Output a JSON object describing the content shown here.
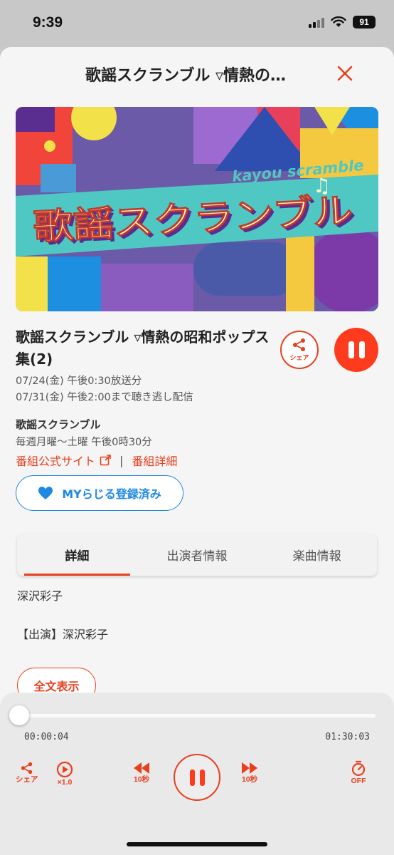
{
  "status_bar": {
    "time": "9:39",
    "battery": "91"
  },
  "header": {
    "title": "歌謡スクランブル ▿情熱の…"
  },
  "artwork": {
    "subtitle_text": "kayou scramble",
    "title_text": "歌謡スクランブル"
  },
  "episode": {
    "title": "歌謡スクランブル ▿情熱の昭和ポップス集(2)",
    "broadcast": "07/24(金) 午後0:30放送分",
    "available_until": "07/31(金) 午後2:00まで聴き逃し配信",
    "share_label": "シェア"
  },
  "program": {
    "name": "歌謡スクランブル",
    "schedule": "毎週月曜～土曜 午後0時30分",
    "official_site": "番組公式サイト",
    "separator": "|",
    "details": "番組詳細",
    "my_button": "MYらじる登録済み"
  },
  "tabs": [
    {
      "label": "詳細",
      "active": true
    },
    {
      "label": "出演者情報",
      "active": false
    },
    {
      "label": "楽曲情報",
      "active": false
    }
  ],
  "content": {
    "line1": "深沢彩子",
    "line2": "【出演】深沢彩子",
    "show_full": "全文表示"
  },
  "player": {
    "current_time": "00:00:04",
    "total_time": "01:30:03",
    "progress": 0.0007,
    "share_label": "シェア",
    "speed_label": "×1.0",
    "rewind_label": "10秒",
    "forward_label": "10秒",
    "timer_label": "OFF"
  },
  "colors": {
    "accent": "#e8401f",
    "play": "#ff3b1e",
    "my_blue": "#1e88e5",
    "sheet_bg": "#f6f5f5"
  }
}
